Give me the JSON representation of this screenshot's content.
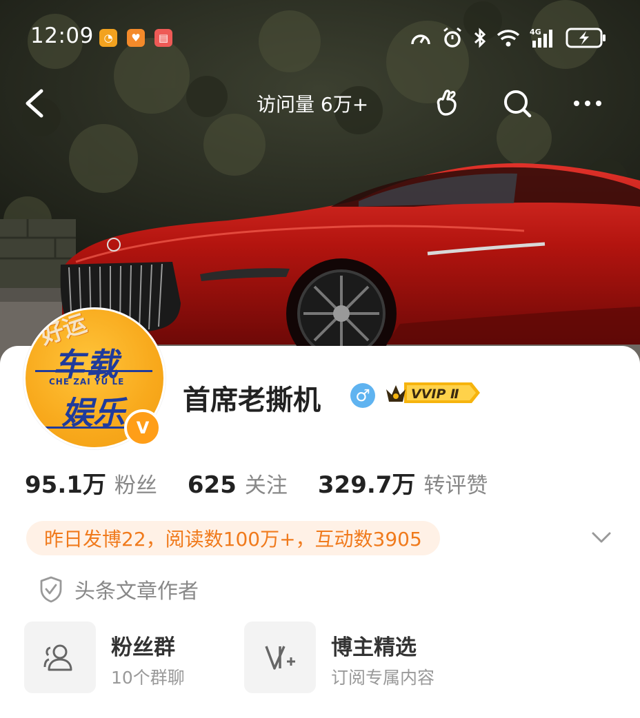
{
  "status_bar": {
    "time": "12:09",
    "network": "4G"
  },
  "nav": {
    "visit_label": "访问量 6万+"
  },
  "profile": {
    "name": "首席老撕机",
    "gender_symbol": "♂",
    "vip_label": "VVIP Ⅱ",
    "verified_badge": "V",
    "avatar_text": {
      "top": "好运",
      "main": "车载",
      "pinyin": "CHE ZAI YU LE",
      "bottom": "娱乐"
    }
  },
  "stats": [
    {
      "value": "95.1万",
      "label": "粉丝"
    },
    {
      "value": "625",
      "label": "关注"
    },
    {
      "value": "329.7万",
      "label": "转评赞"
    }
  ],
  "summary": "昨日发博22，阅读数100万+，互动数3905",
  "author_tag": "头条文章作者",
  "features": [
    {
      "title": "粉丝群",
      "subtitle": "10个群聊",
      "icon": "group-icon"
    },
    {
      "title": "博主精选",
      "subtitle": "订阅专属内容",
      "icon": "featured-icon"
    }
  ],
  "colors": {
    "accent_orange": "#f07a1c",
    "pill_bg": "#fff1e6",
    "gender_blue": "#5fb3f0",
    "vip_gold": "#f6b40e"
  }
}
